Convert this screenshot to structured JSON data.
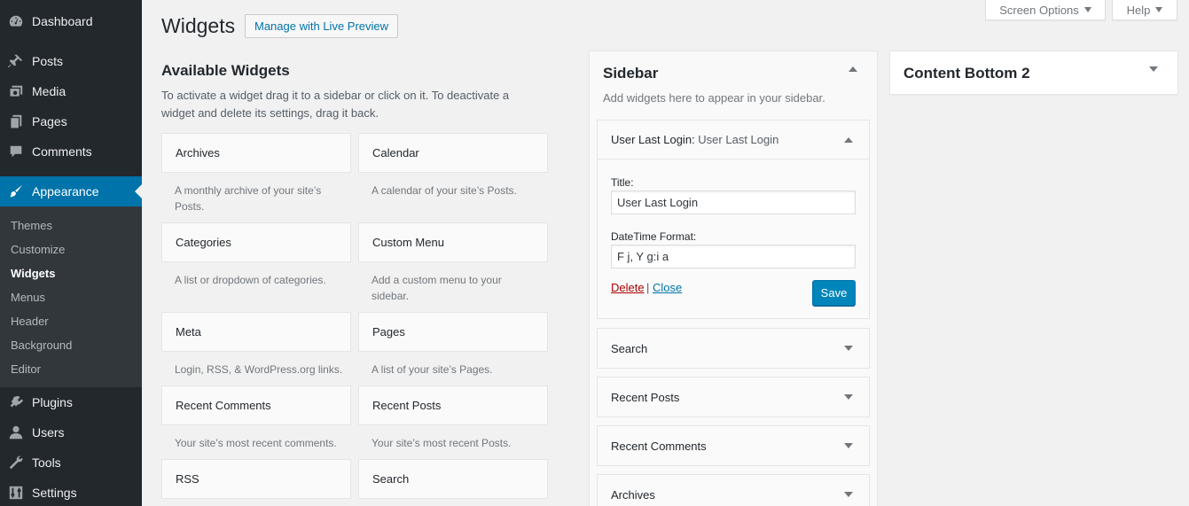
{
  "menu": {
    "dashboard": "Dashboard",
    "posts": "Posts",
    "media": "Media",
    "pages": "Pages",
    "comments": "Comments",
    "appearance": "Appearance",
    "plugins": "Plugins",
    "users": "Users",
    "tools": "Tools",
    "settings": "Settings"
  },
  "submenu": [
    "Themes",
    "Customize",
    "Widgets",
    "Menus",
    "Header",
    "Background",
    "Editor"
  ],
  "top": {
    "screen_options": "Screen Options",
    "help": "Help"
  },
  "page": {
    "title": "Widgets",
    "live_preview": "Manage with Live Preview",
    "available_title": "Available Widgets",
    "available_desc": "To activate a widget drag it to a sidebar or click on it. To deactivate a widget and delete its settings, drag it back."
  },
  "widgets": [
    {
      "name": "Archives",
      "desc": "A monthly archive of your site’s Posts."
    },
    {
      "name": "Calendar",
      "desc": "A calendar of your site’s Posts."
    },
    {
      "name": "Categories",
      "desc": "A list or dropdown of categories."
    },
    {
      "name": "Custom Menu",
      "desc": "Add a custom menu to your sidebar."
    },
    {
      "name": "Meta",
      "desc": "Login, RSS, & WordPress.org links."
    },
    {
      "name": "Pages",
      "desc": "A list of your site’s Pages."
    },
    {
      "name": "Recent Comments",
      "desc": "Your site’s most recent comments."
    },
    {
      "name": "Recent Posts",
      "desc": "Your site’s most recent Posts."
    },
    {
      "name": "RSS",
      "desc": ""
    },
    {
      "name": "Search",
      "desc": ""
    }
  ],
  "sidebar": {
    "title": "Sidebar",
    "desc": "Add widgets here to appear in your sidebar.",
    "open_widget": {
      "name": "User Last Login",
      "title_suffix": "User Last Login",
      "title_label": "Title:",
      "title_value": "User Last Login",
      "format_label": "DateTime Format:",
      "format_value": "F j, Y g:i a",
      "delete": "Delete",
      "separator": "|",
      "close": "Close",
      "save": "Save"
    },
    "widgets": [
      "Search",
      "Recent Posts",
      "Recent Comments",
      "Archives"
    ]
  },
  "content_bottom": {
    "title": "Content Bottom 2"
  },
  "colors": {
    "menu_bg": "#23282d",
    "accent": "#0073aa",
    "button": "#0085ba"
  }
}
